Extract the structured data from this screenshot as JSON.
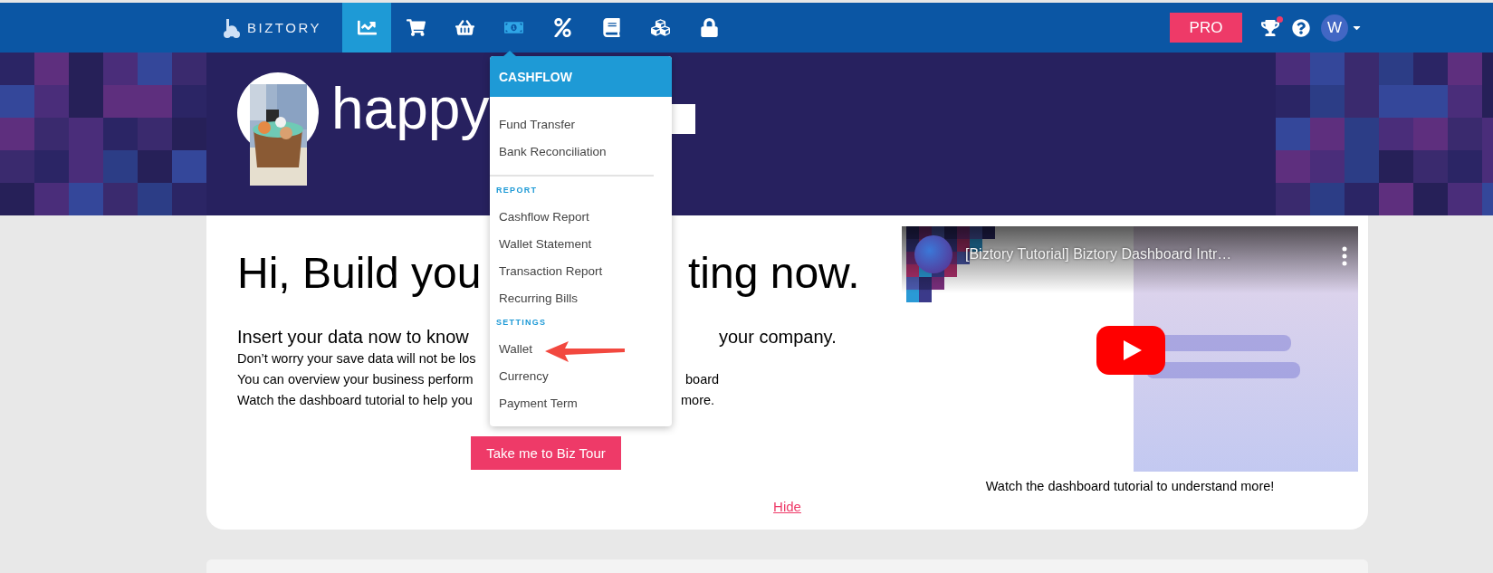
{
  "brand": {
    "name": "BIZTORY"
  },
  "nav_items": [
    {
      "selected": true,
      "open": false
    },
    {
      "selected": false,
      "open": false
    },
    {
      "selected": false,
      "open": false
    },
    {
      "selected": false,
      "open": true
    },
    {
      "selected": false,
      "open": false
    },
    {
      "selected": false,
      "open": false
    },
    {
      "selected": false,
      "open": false
    },
    {
      "selected": false,
      "open": false
    }
  ],
  "account": {
    "plan_button": "PRO",
    "notification": true,
    "avatar_initial": "W"
  },
  "banner": {
    "title": "happy"
  },
  "dropdown": {
    "title": "CASHFLOW",
    "sections": [
      {
        "items": [
          "Fund Transfer",
          "Bank Reconciliation"
        ],
        "divider_after": true
      },
      {
        "heading": "REPORT",
        "items": [
          "Cashflow Report",
          "Wallet Statement",
          "Transaction Report",
          "Recurring Bills"
        ],
        "divider_after": false
      },
      {
        "heading": "SETTINGS",
        "items": [
          "Wallet",
          "Currency",
          "Payment Term"
        ],
        "divider_after": false
      }
    ]
  },
  "welcome": {
    "heading": [
      "Hi, Build you",
      "ting now."
    ],
    "subheading": [
      "Insert your data now to know",
      "your company."
    ],
    "lines": [
      [
        "Don’t worry your save data will not be los"
      ],
      [
        "You can overview your business perform",
        "board"
      ],
      [
        "Watch the dashboard tutorial to help you",
        "more."
      ]
    ],
    "button": "Take me to Biz Tour",
    "hide_link": "Hide"
  },
  "video": {
    "title": "[Biztory Tutorial] Biztory Dashboard Intr…",
    "caption": "Watch the dashboard tutorial to understand more!"
  }
}
